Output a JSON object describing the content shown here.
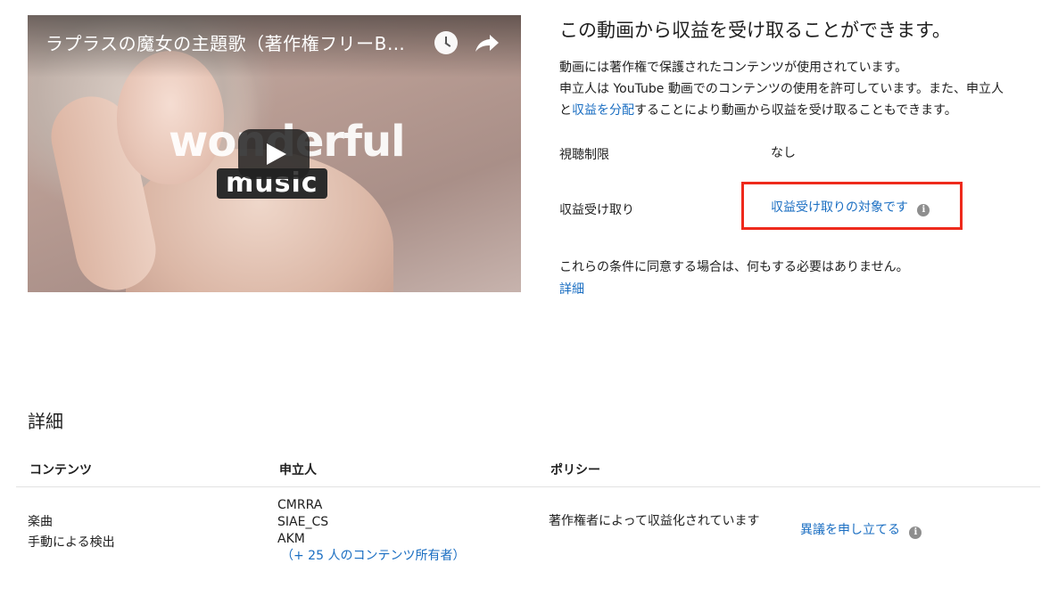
{
  "video": {
    "title": "ラプラスの魔女の主題歌（著作権フリーB…",
    "thumbnail_text": "wonderful",
    "thumbnail_badge": "music",
    "icons": [
      "clock-icon",
      "share-icon",
      "play-icon"
    ]
  },
  "panel": {
    "title": "この動画から収益を受け取ることができます。",
    "desc_line1": "動画には著作権で保護されたコンテンツが使用されています。",
    "desc_line2": "申立人は YouTube 動画でのコンテンツの使用を許可しています。また、申立人",
    "desc_line3_pre": "と",
    "desc_line3_link": "収益を分配",
    "desc_line3_post": "することにより動画から収益を受け取ることもできます。",
    "viewing_restriction_label": "視聴制限",
    "viewing_restriction_value": "なし",
    "monetization_label": "収益受け取り",
    "monetization_value": "収益受け取りの対象です",
    "agree_text": "これらの条件に同意する場合は、何もする必要はありません。",
    "details_link": "詳細",
    "highlight_color": "#ee2a1c",
    "link_color": "#1a6ec2"
  },
  "details": {
    "title": "詳細",
    "headers": [
      "コンテンツ",
      "申立人",
      "ポリシー"
    ],
    "row": {
      "content": [
        "楽曲",
        "手動による検出"
      ],
      "claimants": [
        "CMRRA",
        "SIAE_CS",
        "AKM"
      ],
      "claimants_more": "（+ 25 人のコンテンツ所有者）",
      "policy": "著作権者によって収益化されています",
      "dispute": "異議を申し立てる"
    }
  }
}
